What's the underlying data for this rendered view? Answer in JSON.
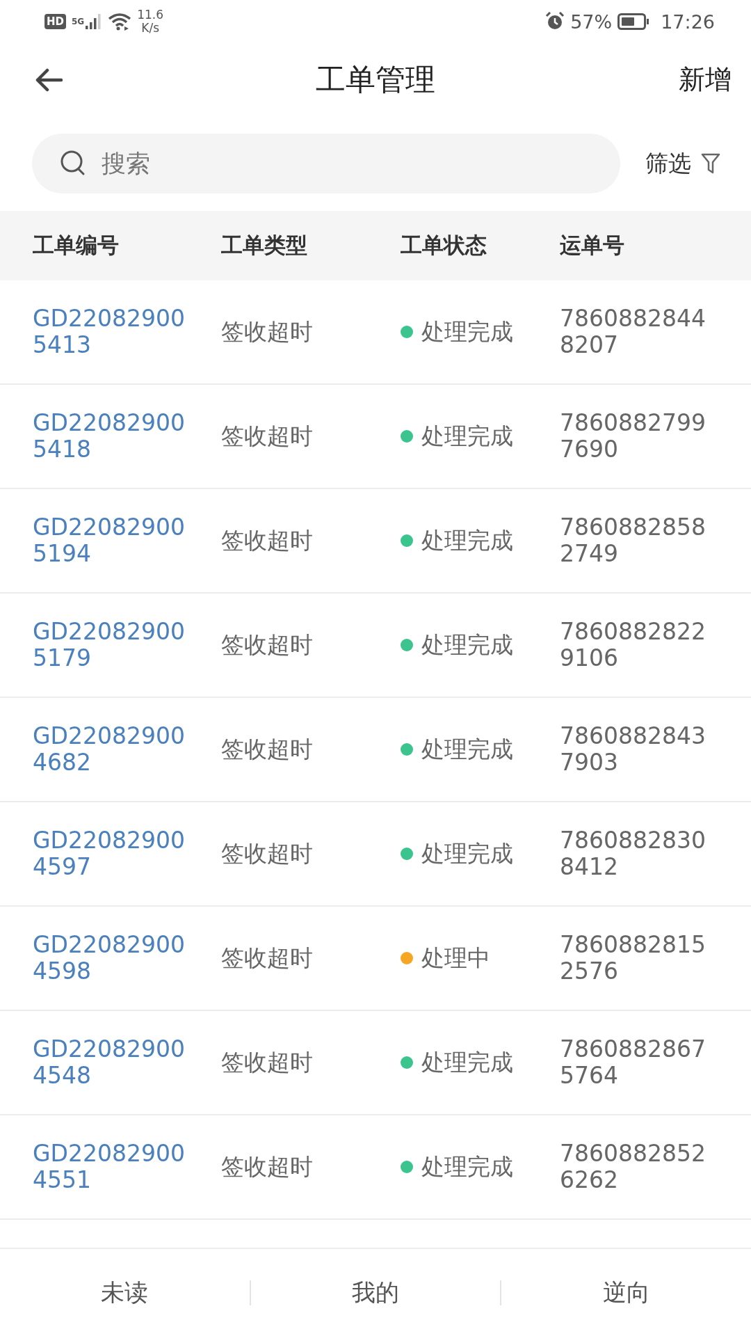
{
  "status_bar": {
    "hd": "HD",
    "network": "5G",
    "speed_value": "11.6",
    "speed_unit": "K/s",
    "battery": "57%",
    "time": "17:26"
  },
  "header": {
    "title": "工单管理",
    "action": "新增"
  },
  "search": {
    "placeholder": "搜索"
  },
  "filter": {
    "label": "筛选"
  },
  "table": {
    "columns": [
      "工单编号",
      "工单类型",
      "工单状态",
      "运单号"
    ],
    "rows": [
      {
        "id": [
          "GD22082900",
          "5413"
        ],
        "type": "签收超时",
        "status": "处理完成",
        "color": "#3cc48e",
        "waybill": [
          "7860882844",
          "8207"
        ]
      },
      {
        "id": [
          "GD22082900",
          "5418"
        ],
        "type": "签收超时",
        "status": "处理完成",
        "color": "#3cc48e",
        "waybill": [
          "7860882799",
          "7690"
        ]
      },
      {
        "id": [
          "GD22082900",
          "5194"
        ],
        "type": "签收超时",
        "status": "处理完成",
        "color": "#3cc48e",
        "waybill": [
          "7860882858",
          "2749"
        ]
      },
      {
        "id": [
          "GD22082900",
          "5179"
        ],
        "type": "签收超时",
        "status": "处理完成",
        "color": "#3cc48e",
        "waybill": [
          "7860882822",
          "9106"
        ]
      },
      {
        "id": [
          "GD22082900",
          "4682"
        ],
        "type": "签收超时",
        "status": "处理完成",
        "color": "#3cc48e",
        "waybill": [
          "7860882843",
          "7903"
        ]
      },
      {
        "id": [
          "GD22082900",
          "4597"
        ],
        "type": "签收超时",
        "status": "处理完成",
        "color": "#3cc48e",
        "waybill": [
          "7860882830",
          "8412"
        ]
      },
      {
        "id": [
          "GD22082900",
          "4598"
        ],
        "type": "签收超时",
        "status": "处理中",
        "color": "#f5a623",
        "waybill": [
          "7860882815",
          "2576"
        ]
      },
      {
        "id": [
          "GD22082900",
          "4548"
        ],
        "type": "签收超时",
        "status": "处理完成",
        "color": "#3cc48e",
        "waybill": [
          "7860882867",
          "5764"
        ]
      },
      {
        "id": [
          "GD22082900",
          "4551"
        ],
        "type": "签收超时",
        "status": "处理完成",
        "color": "#3cc48e",
        "waybill": [
          "7860882852",
          "6262"
        ]
      }
    ]
  },
  "bottom_tabs": [
    "未读",
    "我的",
    "逆向"
  ]
}
